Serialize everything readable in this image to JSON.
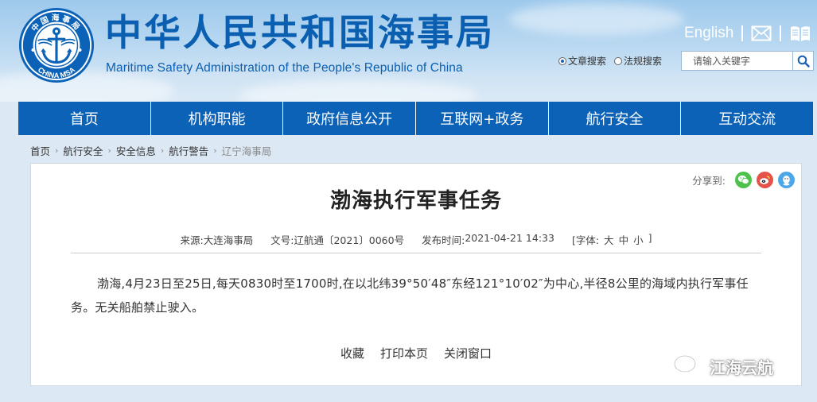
{
  "header": {
    "title_cn": "中华人民共和国海事局",
    "title_en": "Maritime Safety Administration of the People's Republic of China",
    "logo_text": "CHINA MSA",
    "logo_ring_text": "中国海事局",
    "english_link": "English",
    "search_options": [
      {
        "label": "文章搜索",
        "selected": true
      },
      {
        "label": "法规搜索",
        "selected": false
      }
    ],
    "search_placeholder": "请输入关键字"
  },
  "nav": {
    "items": [
      "首页",
      "机构职能",
      "政府信息公开",
      "互联网+政务",
      "航行安全",
      "互动交流"
    ]
  },
  "breadcrumb": {
    "items": [
      "首页",
      "航行安全",
      "安全信息",
      "航行警告",
      "辽宁海事局"
    ]
  },
  "article": {
    "share_label": "分享到:",
    "title": "渤海执行军事任务",
    "meta": {
      "source_label": "来源:",
      "source": "大连海事局",
      "doc_label": "文号:",
      "doc_no": "辽航通〔2021〕0060号",
      "time_label": "发布时间:",
      "time": "2021-04-21 14:33",
      "font_label": "[字体:",
      "font_sizes": [
        "大",
        "中",
        "小"
      ],
      "font_close": "]"
    },
    "body": "渤海,4月23日至25日,每天0830时至1700时,在以北纬39°50′48″东经121°10′02″为中心,半径8公里的海域内执行军事任务。无关船舶禁止驶入。",
    "actions": [
      "收藏",
      "打印本页",
      "关闭窗口"
    ]
  },
  "watermark": {
    "text": "江海云航"
  },
  "colors": {
    "brand_blue": "#0b62b7",
    "title_blue": "#0a5fb1",
    "wechat": "#4cc24a",
    "weibo": "#e5524a",
    "qq": "#4ca7e8"
  }
}
